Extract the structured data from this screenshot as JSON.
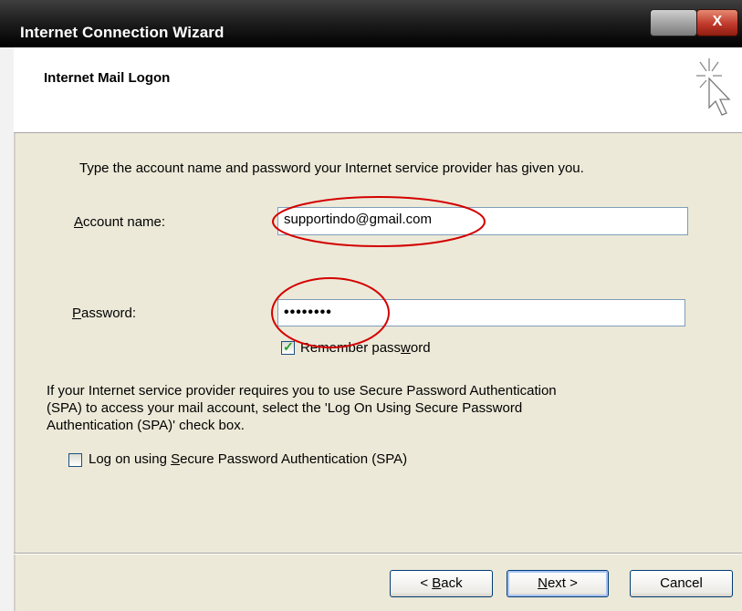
{
  "window": {
    "title": "Internet Connection Wizard",
    "close_glyph": "X"
  },
  "header": {
    "title": "Internet Mail Logon",
    "icon": "wizard-cursor-icon"
  },
  "intro": "Type the account name and password your Internet service provider has given you.",
  "account": {
    "label_pre": "",
    "label_accel": "A",
    "label_post": "ccount name:",
    "value": "supportindo@gmail.com"
  },
  "password": {
    "label_pre": "",
    "label_accel": "P",
    "label_post": "assword:",
    "value": "••••••••"
  },
  "remember": {
    "checked": true,
    "label_pre": "Remember pass",
    "label_accel": "w",
    "label_post": "ord"
  },
  "spa_note": {
    "line1": "If your Internet service provider requires you to use Secure Password Authentication",
    "line2": "(SPA) to access your mail account, select the 'Log On Using Secure Password",
    "line3": "Authentication (SPA)' check box."
  },
  "spa_checkbox": {
    "checked": false,
    "label_pre": "Log on using ",
    "label_accel": "S",
    "label_post": "ecure Password Authentication (SPA)"
  },
  "buttons": {
    "back": {
      "pre": "< ",
      "accel": "B",
      "post": "ack"
    },
    "next": {
      "pre": "",
      "accel": "N",
      "post": "ext >"
    },
    "cancel": "Cancel"
  },
  "colors": {
    "annotation": "#d40000",
    "title_bar": "#1f1f1f",
    "dialog_bg": "#ece9d8"
  }
}
